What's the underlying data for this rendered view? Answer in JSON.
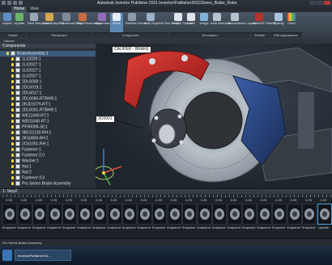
{
  "window": {
    "title": "Autodesk Inventor Publisher 2011   Inventor\\Publisher2011\\Demo_Brake_Rotor"
  },
  "tabs": [
    "Home",
    "View"
  ],
  "ribbon": {
    "buttons": [
      {
        "label": "Import"
      },
      {
        "label": "Update"
      },
      {
        "label": "New Storyboard"
      },
      {
        "label": "New Snapshot"
      },
      {
        "label": "Thumbnail View"
      },
      {
        "label": "Play Presentation"
      },
      {
        "label": "Appearance"
      },
      {
        "label": "Move"
      },
      {
        "label": "Restore Home"
      },
      {
        "label": "Auto Explode One Level"
      },
      {
        "label": "Simple Callout"
      },
      {
        "label": "Label"
      },
      {
        "label": "Image"
      },
      {
        "label": "Auto Annotate"
      },
      {
        "label": "Annotations Layout"
      },
      {
        "label": "Adobe® Flash®"
      },
      {
        "label": "Opacity"
      },
      {
        "label": "Color"
      }
    ],
    "groups": [
      "Model",
      "Storyboard",
      "Component",
      "Annotation",
      "Publish",
      "Edit Appearance"
    ]
  },
  "canvas_bar": {
    "label": "Canvas"
  },
  "browser": {
    "title": "Components",
    "nodes": [
      "BrakeAssembly:1",
      "1L02029:1",
      "1L02027:1",
      "1L02027:1",
      "1L02027:1",
      "2DL6000:1",
      "2DL6019:1",
      "2DL6017:1",
      "2DL6065-RTBHR:1",
      "2K3D1079-RT:1",
      "2DL6001-RTBHR:1",
      "WE11040-RT:1",
      "WE01040-RT:1",
      "PF00009-30:1",
      "9BD21130-RH:1",
      "2K50009-RH:1",
      "2C61001-RH:1",
      "Fastener:1",
      "Fastener:2.0",
      "Washer:1",
      "Nut:1",
      "Nut:2",
      "Fastener:3:3",
      "Pro Series Brake Assembly"
    ],
    "selected_index": 0
  },
  "viewport": {
    "callouts": [
      {
        "text": "CALIPER - BRAKE"
      },
      {
        "text": "3C0001"
      }
    ]
  },
  "storyboard": {
    "label": "1: Step2"
  },
  "snapshots": {
    "duration": "0.25",
    "name": "Snapshot",
    "count": 22,
    "last_label": "Update"
  },
  "statusbar": {
    "text": "Pro Series Brake Assembly"
  },
  "taskbar": {
    "item": "InventorPublisher201..."
  },
  "colors": {
    "ribbon_top": "#4a5664",
    "panel": "#2a3037",
    "caliper_red": "#c2201d",
    "rotor_silver": "#b8c0c8",
    "hub_dark": "#2f3338",
    "accent_blue": "#4aa3e0",
    "bulb_yellow": "#f1d63a"
  }
}
